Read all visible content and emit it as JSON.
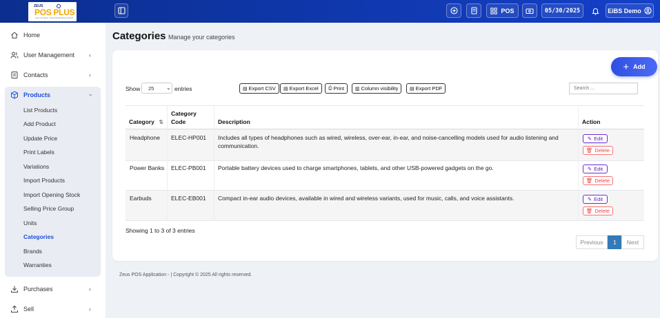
{
  "brand": {
    "logo_small": "ZEUS",
    "logo_big": "POS PLUS",
    "logo_tagline": "LET US HELP YOUR BUSINESS GROW"
  },
  "topbar": {
    "pos_label": "POS",
    "date": "05/30/2025",
    "user": "EiBS Demo"
  },
  "sidebar": {
    "items": [
      {
        "label": "Home",
        "icon": "home-icon"
      },
      {
        "label": "User Management",
        "icon": "users-icon"
      },
      {
        "label": "Contacts",
        "icon": "contacts-icon"
      },
      {
        "label": "Products",
        "icon": "box-icon"
      },
      {
        "label": "Purchases",
        "icon": "download-icon"
      },
      {
        "label": "Sell",
        "icon": "upload-icon"
      }
    ],
    "product_sub": [
      "List Products",
      "Add Product",
      "Update Price",
      "Print Labels",
      "Variations",
      "Import Products",
      "Import Opening Stock",
      "Selling Price Group",
      "Units",
      "Categories",
      "Brands",
      "Warranties"
    ],
    "active_sub": "Categories"
  },
  "page": {
    "title": "Categories",
    "subtitle": "Manage your categories",
    "add_label": "Add"
  },
  "controls": {
    "show_label": "Show",
    "page_size": "25",
    "entries_label": "entries",
    "search_placeholder": "Search ...",
    "export_buttons": [
      "Export CSV",
      "Export Excel",
      "Print",
      "Column visibility",
      "Export PDF"
    ]
  },
  "table": {
    "columns": [
      "Category",
      "Category Code",
      "Description",
      "Action"
    ],
    "rows": [
      {
        "category": "Headphone",
        "code": "ELEC-HP001",
        "description": "Includes all types of headphones such as wired, wireless, over-ear, in-ear, and noise-cancelling models used for audio listening and communication."
      },
      {
        "category": "Power Banks",
        "code": "ELEC-PB001",
        "description": "Portable battery devices used to charge smartphones, tablets, and other USB-powered gadgets on the go."
      },
      {
        "category": "Earbuds",
        "code": "ELEC-EB001",
        "description": "Compact in-ear audio devices, available in wired and wireless variants, used for music, calls, and voice assistants."
      }
    ],
    "edit_label": "Edit",
    "delete_label": "Delete"
  },
  "pagination": {
    "info": "Showing 1 to 3 of 3 entries",
    "previous": "Previous",
    "current": "1",
    "next": "Next"
  },
  "footer": "Zeus POS Application - | Copyright © 2025 All rights reserved.",
  "colors": {
    "topbar": "#1440c8",
    "accent": "#1d4ed8",
    "edit": "#5b21b6",
    "delete": "#ef4444",
    "page_active": "#337ab7"
  }
}
